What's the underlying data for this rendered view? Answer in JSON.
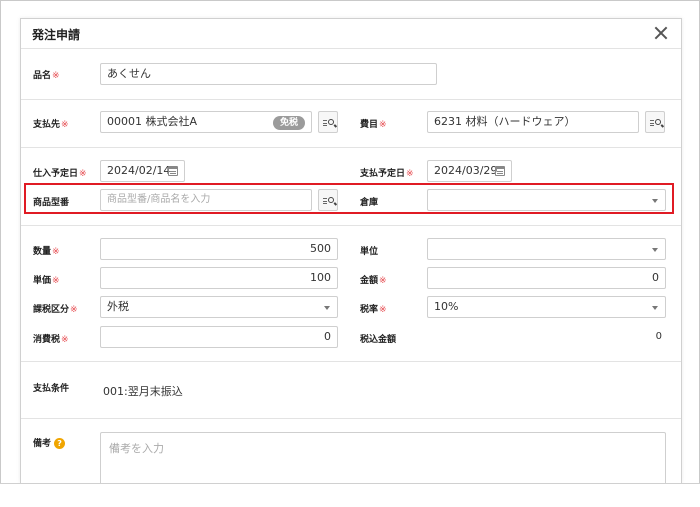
{
  "modal": {
    "title": "発注申請"
  },
  "required_mark": "※",
  "fields": {
    "product_name": {
      "label": "品名",
      "value": "あくせん"
    },
    "supplier": {
      "label": "支払先",
      "value": "00001 株式会社A",
      "badge": "免税"
    },
    "account": {
      "label": "費目",
      "value": "6231 材料（ハードウェア）"
    },
    "purchase_date": {
      "label": "仕入予定日",
      "value": "2024/02/14"
    },
    "payment_date": {
      "label": "支払予定日",
      "value": "2024/03/29"
    },
    "product_code": {
      "label": "商品型番",
      "placeholder": "商品型番/商品名を入力"
    },
    "warehouse": {
      "label": "倉庫",
      "value": ""
    },
    "quantity": {
      "label": "数量",
      "value": "500"
    },
    "unit": {
      "label": "単位",
      "value": ""
    },
    "unit_price": {
      "label": "単価",
      "value": "100"
    },
    "amount": {
      "label": "金額",
      "value": "0"
    },
    "tax_category": {
      "label": "課税区分",
      "value": "外税"
    },
    "tax_rate": {
      "label": "税率",
      "value": "10%"
    },
    "consumption_tax": {
      "label": "消費税",
      "value": "0"
    },
    "tax_included": {
      "label": "税込金額",
      "value": "0"
    },
    "payment_terms": {
      "label": "支払条件",
      "value": "001:翌月末振込"
    },
    "notes": {
      "label": "備考",
      "placeholder": "備考を入力",
      "help": "?"
    }
  },
  "colors": {
    "required": "#e5484d",
    "highlight": "#e01b24",
    "badge": "#9b9b9b",
    "help": "#f0a500"
  }
}
